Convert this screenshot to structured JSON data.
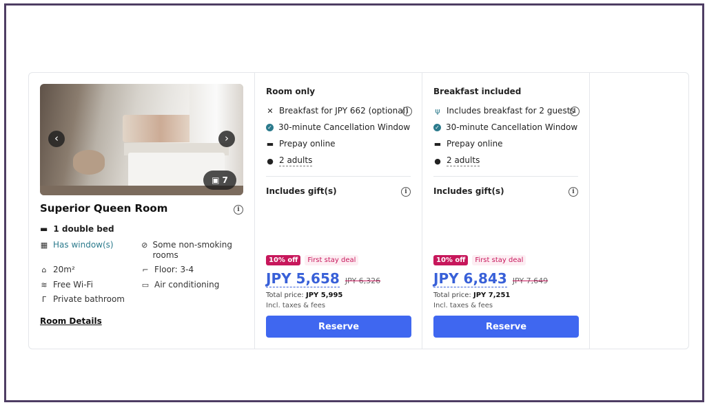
{
  "room": {
    "photo_count": "7",
    "title": "Superior Queen Room",
    "bed": "1 double bed",
    "facilities": {
      "window": "Has window(s)",
      "smoking": "Some non-smoking rooms",
      "size": "20m²",
      "floor": "Floor: 3-4",
      "wifi": "Free Wi-Fi",
      "ac": "Air conditioning",
      "bathroom": "Private bathroom"
    },
    "details_link": "Room Details"
  },
  "offers": [
    {
      "title": "Room only",
      "meal": "Breakfast for JPY 662 (optional)",
      "cancellation": "30-minute Cancellation Window",
      "payment": "Prepay online",
      "guests": "2 adults",
      "gift": "Includes gift(s)",
      "discount": "10% off",
      "deal": "First stay deal",
      "price": "JPY 5,658",
      "old_price": "JPY 6,326",
      "total_label": "Total price:",
      "total_value": "JPY 5,995",
      "taxes": "Incl. taxes & fees",
      "reserve": "Reserve"
    },
    {
      "title": "Breakfast included",
      "meal": "Includes breakfast for 2 guests",
      "cancellation": "30-minute Cancellation Window",
      "payment": "Prepay online",
      "guests": "2 adults",
      "gift": "Includes gift(s)",
      "discount": "10% off",
      "deal": "First stay deal",
      "price": "JPY 6,843",
      "old_price": "JPY 7,649",
      "total_label": "Total price:",
      "total_value": "JPY 7,251",
      "taxes": "Incl. taxes & fees",
      "reserve": "Reserve"
    }
  ],
  "colors": {
    "accent": "#3f67f0",
    "price": "#3860d8",
    "teal": "#2b7a8c",
    "deal": "#c7175b",
    "frame": "#4e3d63"
  },
  "icons": {
    "prev": "chevron-left-icon",
    "next": "chevron-right-icon",
    "photos": "image-icon",
    "info": "info-icon"
  }
}
